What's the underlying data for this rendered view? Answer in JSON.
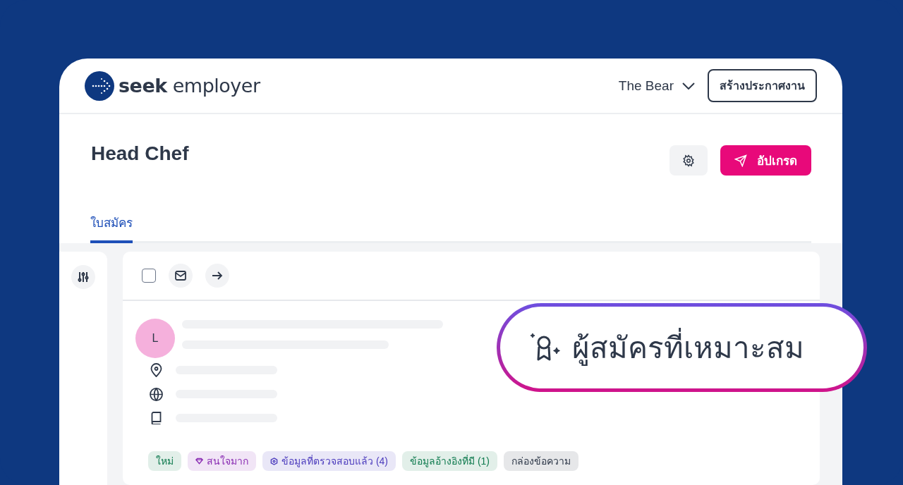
{
  "header": {
    "logo_text": "**seek** employer",
    "account": "The Bear",
    "post_job_button": "สร้างประกาศงาน"
  },
  "job": {
    "title": "Head Chef",
    "upgrade_button": "อัปเกรด"
  },
  "tabs": [
    {
      "label": "ใบสมัคร",
      "selected": true
    }
  ],
  "toolbar": {
    "select_all_checked": false
  },
  "candidate": {
    "avatar_letter": "L",
    "tags": [
      {
        "label": "ใหม่",
        "kind": "plain",
        "color": "#0e7a4e"
      },
      {
        "label": "สนใจมาก",
        "kind": "gem",
        "color": "#8a2db3"
      },
      {
        "label": "ข้อมูลที่ตรวจสอบแล้ว (4)",
        "kind": "shield",
        "color": "#4b3bbd"
      },
      {
        "label": "ข้อมูลอ้างอิงที่มี (1)",
        "kind": "plain",
        "color": "#0e7a4e"
      },
      {
        "label": "กล่องข้อความ",
        "kind": "plain",
        "color": "#2e3849"
      }
    ]
  },
  "highlight": {
    "label": "ผู้สมัครที่เหมาะสม"
  }
}
